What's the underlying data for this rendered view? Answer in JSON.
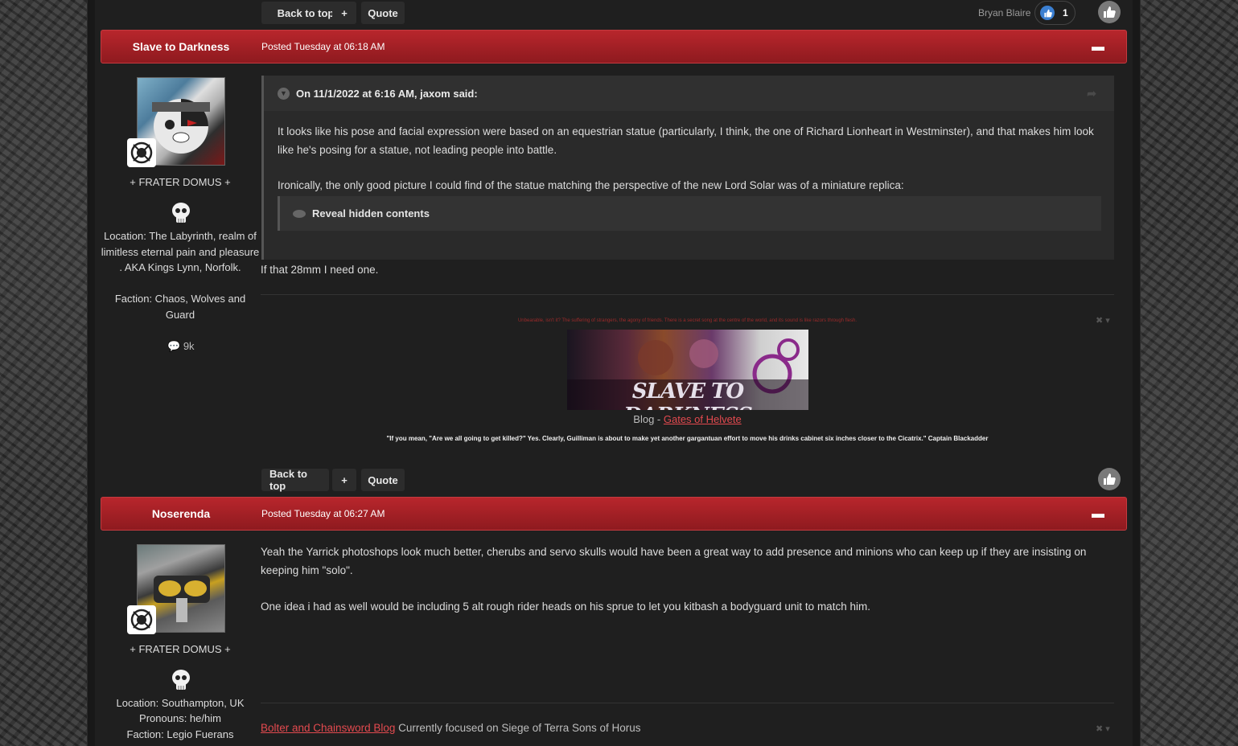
{
  "post_actions": {
    "back_to_top": "Back to top",
    "plus": "+",
    "quote": "Quote"
  },
  "top_likes": {
    "liker": "Bryan Blaire",
    "count": "1"
  },
  "post1": {
    "author": "Slave to Darkness",
    "posted": "Posted Tuesday at 06:18 AM",
    "rank": "+ FRATER DOMUS +",
    "location": "Location: The Labyrinth, realm of limitless eternal pain and pleasure . AKA Kings Lynn, Norfolk.",
    "faction": "Faction: Chaos, Wolves and Guard",
    "posts": "9k",
    "quote_header": "On 11/1/2022 at 6:16 AM, jaxom said:",
    "quote_p1": "It looks like his pose and facial expression were based on an equestrian statue (particularly, I think, the one of Richard Lionheart in Westminster), and that makes him look like he's posing for a statue, not leading people into battle.",
    "quote_p2": "Ironically, the only good picture I could find of the statue matching the perspective of the new Lord Solar was of a miniature replica:",
    "spoiler": "Reveal hidden contents",
    "reply": "If that 28mm I need one.",
    "sig_quote_small": "Unbearable, isn't it? The suffering of strangers, the agony of friends. There is a secret song at the centre of the world, and its sound is like razors through flesh.",
    "sig_banner_text": "SLAVE TO DARKNESS",
    "sig_blog_prefix": "Blog - ",
    "sig_blog_link": "Gates of Helvete",
    "sig_quote_bold": "\"If you mean, \"Are we all going to get killed?\" Yes. Clearly, Guilliman is about to make yet another gargantuan effort to move his drinks cabinet six inches closer to the Cicatrix.\" Captain Blackadder"
  },
  "post2": {
    "author": "Noserenda",
    "posted": "Posted Tuesday at 06:27 AM",
    "rank": "+ FRATER DOMUS +",
    "location": "Location: Southampton, UK",
    "pronouns": "Pronouns: he/him",
    "faction": "Faction: Legio Fuerans",
    "p1": "Yeah the Yarrick photoshops look much better, cherubs and servo skulls would have been a great way to add presence and minions who can keep up if they are insisting on keeping him \"solo\".",
    "p2": "One idea i had as well would be including 5 alt rough rider heads on his sprue to let you kitbash a bodyguard unit to match him.",
    "sig_link": "Bolter and Chainsword Blog",
    "sig_text": " Currently focused on Siege of Terra Sons of Horus"
  },
  "colors": {
    "header_red": "#b8262c",
    "link_red": "#e34a4f",
    "bg_dark": "#1f1f1f"
  },
  "icons": [
    "thumbs-up-icon",
    "ellipsis-icon",
    "quote-chevron-icon",
    "share-icon",
    "eye-icon",
    "comment-icon",
    "close-icon",
    "skull-icon",
    "rank-badge-icon"
  ]
}
